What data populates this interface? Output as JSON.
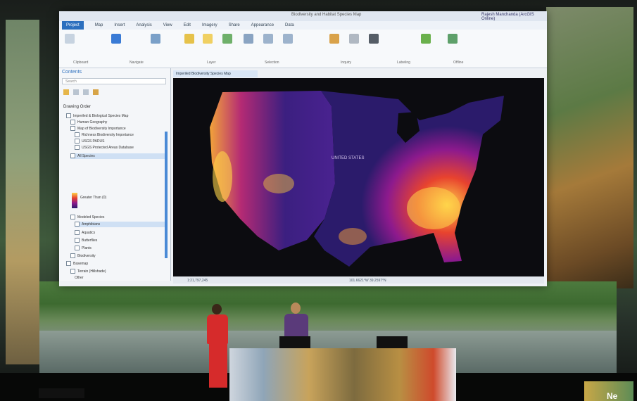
{
  "screen": {
    "app_title": "Biodiversity and Habitat Species Map",
    "user_label": "Rajesh Manchanda (ArcGIS Online)",
    "ribbon_tabs": [
      "Project",
      "Map",
      "Insert",
      "Analysis",
      "View",
      "Edit",
      "Imagery",
      "Share",
      "Appearance",
      "Data"
    ],
    "ribbon_groups": [
      "Clipboard",
      "Navigate",
      "Layer",
      "Selection",
      "Inquiry",
      "Labeling",
      "Offline"
    ],
    "contents": {
      "header": "Contents",
      "search_placeholder": "Search",
      "section": "Drawing Order",
      "layers": [
        "Imperiled & Biological Species Map",
        "Human Geography",
        "Map of Biodiversity Importance",
        "Richness Biodiversity Importance",
        "USGS PADUS",
        "USGS Protected Areas Database",
        "All Species",
        "Greater Than (0)",
        "Modeled Species",
        "Amphibians",
        "Aquatics",
        "Butterflies",
        "Plants",
        "Biodiversity",
        "Basemap",
        "Terrain (Hillshade)",
        "Other"
      ]
    },
    "map_tab": "Imperiled Biodiversity Species Map",
    "map_labels": [
      "UNITED STATES"
    ],
    "status_scale": "1:21,797,245",
    "status_coords": "101.6621°W 39.2597°N"
  },
  "colors": {
    "heat_low": "#2b1b6b",
    "heat_mid": "#8d1a8d",
    "heat_high": "#e8432e",
    "heat_top": "#ffd54a",
    "presenter_dress": "#d62b2b",
    "presenter_shirt": "#5a3a7a"
  },
  "scene": {
    "corner_text": "Ne"
  }
}
